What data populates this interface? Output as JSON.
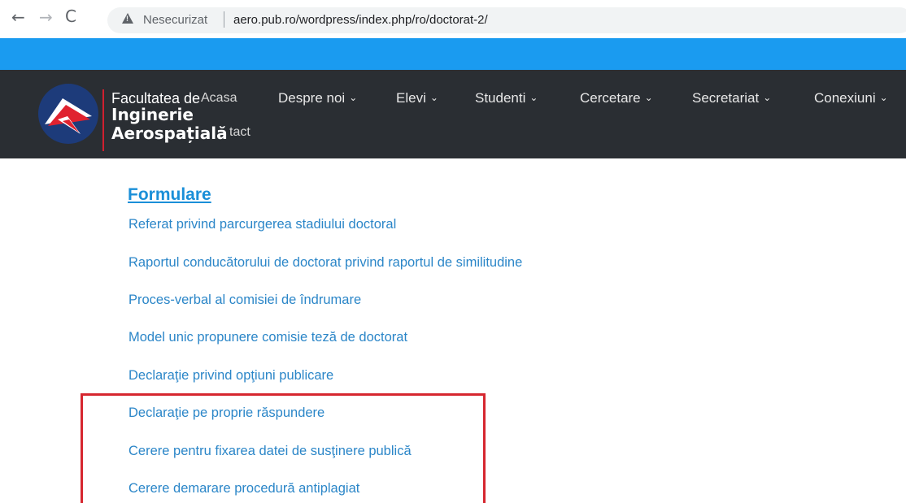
{
  "browser": {
    "back_glyph": "←",
    "forward_glyph": "→",
    "reload_glyph": "C",
    "security_label": "Nesecurizat",
    "url": "aero.pub.ro/wordpress/index.php/ro/doctorat-2/"
  },
  "header": {
    "brand_line1": "Facultatea de",
    "brand_line2": "Inginerie",
    "brand_line3": "Aerospațială",
    "menu": [
      {
        "label": "Acasa"
      },
      {
        "label": "Despre noi"
      },
      {
        "label": "Elevi"
      },
      {
        "label": "Studenti"
      },
      {
        "label": "Cercetare"
      },
      {
        "label": "Secretariat"
      },
      {
        "label": "Conexiuni"
      },
      {
        "label": "tact"
      }
    ],
    "chevron_glyph": "⌄"
  },
  "content": {
    "section_title": "Formulare",
    "links": [
      "Referat privind parcurgerea stadiului doctoral",
      "Raportul conducătorului de doctorat privind raportul de similitudine",
      "Proces-verbal al comisiei de îndrumare",
      "Model unic propunere comisie teză de doctorat",
      "Declaraţie privind opţiuni publicare",
      "Declaraţie pe proprie răspundere",
      "Cerere pentru fixarea datei de susţinere publică",
      "Cerere demarare procedură antiplagiat"
    ]
  },
  "colors": {
    "blue_strip": "#1a9bf0",
    "header_bg": "#2a2e33",
    "link": "#2b86c8",
    "highlight": "#d6262f"
  }
}
